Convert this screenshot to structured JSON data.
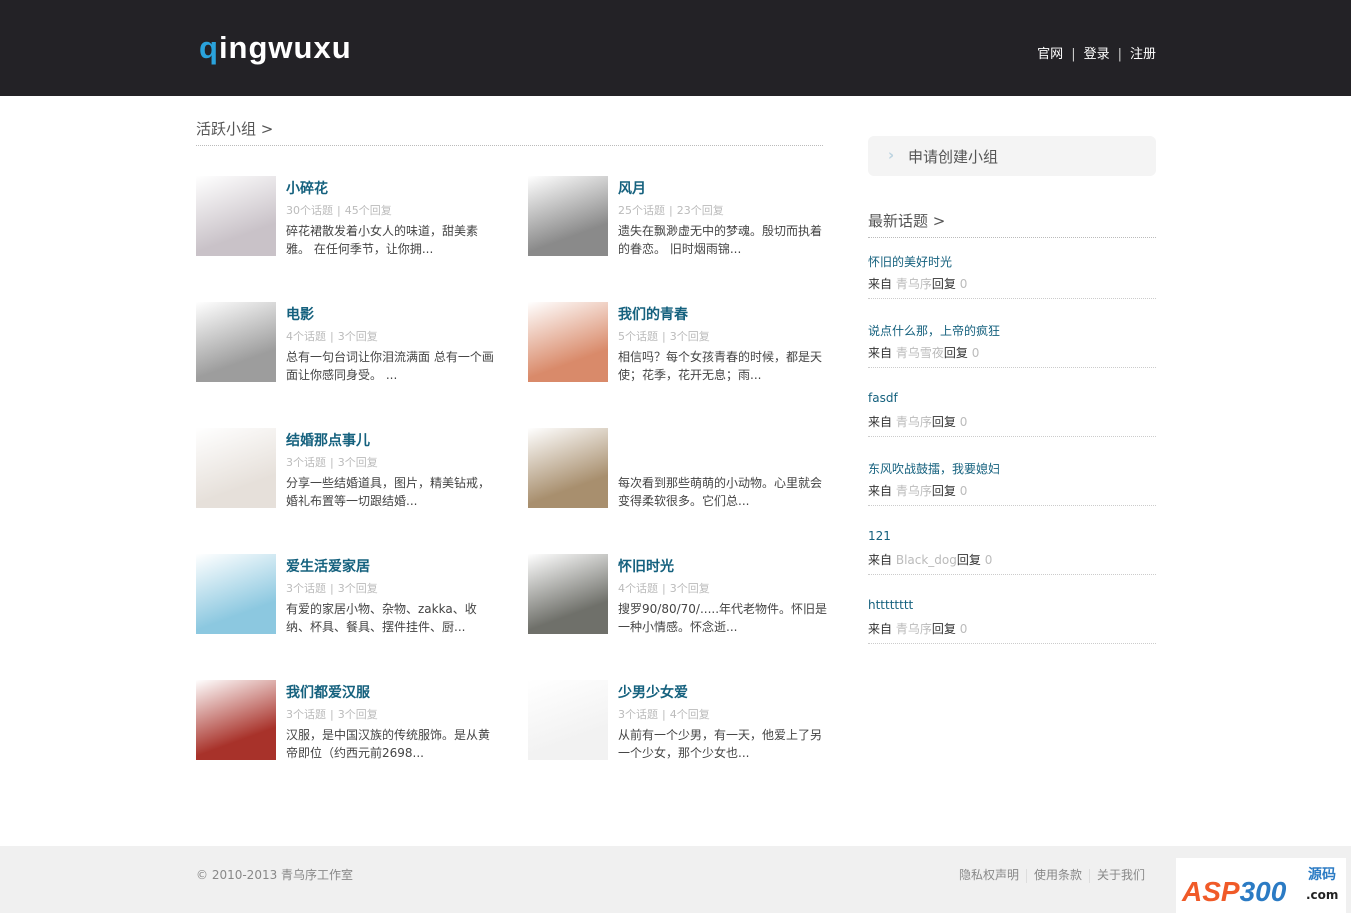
{
  "header": {
    "logo": "qingwuxu",
    "logo_first": "q",
    "logo_rest": "ingwuxu",
    "nav": [
      "官网",
      "登录",
      "注册"
    ],
    "nav_sep": "|"
  },
  "groups_section": {
    "title": "活跃小组 >",
    "groups": [
      {
        "title": "小碎花",
        "topics": "30个话题",
        "replies": "45个回复",
        "desc": "碎花裙散发着小女人的味道，甜美素雅。 在任何季节，让你拥...",
        "color": "#c9c2c8"
      },
      {
        "title": "风月",
        "topics": "25个话题",
        "replies": "23个回复",
        "desc": "遗失在飘渺虚无中的梦魂。殷切而执着的眷恋。 旧时烟雨锦...",
        "color": "#8a8a8a"
      },
      {
        "title": "电影",
        "topics": "4个话题",
        "replies": "3个回复",
        "desc": "总有一句台词让你泪流满面 总有一个画面让你感同身受。 ...",
        "color": "#9d9d9d"
      },
      {
        "title": "我们的青春",
        "topics": "5个话题",
        "replies": "3个回复",
        "desc": "相信吗？每个女孩青春的时候，都是天使；花季，花开无息；雨...",
        "color": "#d98a6a"
      },
      {
        "title": "结婚那点事儿",
        "topics": "3个话题",
        "replies": "3个回复",
        "desc": "分享一些结婚道具，图片，精美钻戒，婚礼布置等一切跟结婚...",
        "color": "#e6e0da"
      },
      {
        "title": "",
        "topics": "",
        "replies": "",
        "desc": "每次看到那些萌萌的小动物。心里就会变得柔软很多。它们总...",
        "color": "#a88f6e"
      },
      {
        "title": "爱生活爱家居",
        "topics": "3个话题",
        "replies": "3个回复",
        "desc": "有爱的家居小物、杂物、zakka、收纳、杯具、餐具、摆件挂件、厨...",
        "color": "#8cc8e0"
      },
      {
        "title": "怀旧时光",
        "topics": "4个话题",
        "replies": "3个回复",
        "desc": "搜罗90/80/70/.....年代老物件。怀旧是一种小情感。怀念逝...",
        "color": "#6f706a"
      },
      {
        "title": "我们都爱汉服",
        "topics": "3个话题",
        "replies": "3个回复",
        "desc": "汉服，是中国汉族的传统服饰。是从黄帝即位（约西元前2698...",
        "color": "#a8322a"
      },
      {
        "title": "少男少女爱",
        "topics": "3个话题",
        "replies": "4个回复",
        "desc": "从前有一个少男，有一天，他爱上了另一个少女，那个少女也...",
        "color": "#f2f2f2"
      }
    ]
  },
  "sidebar": {
    "apply_label": "申请创建小组",
    "latest_title": "最新话题 >",
    "from_label": "来自",
    "reply_label": "回复",
    "topics": [
      {
        "title": "怀旧的美好时光",
        "author": "青乌序",
        "replies": "0"
      },
      {
        "title": "说点什么那，上帝的疯狂",
        "author": "青乌雪夜",
        "replies": "0"
      },
      {
        "title": "fasdf",
        "author": "青乌序",
        "replies": "0"
      },
      {
        "title": "东风吹战鼓擂，我要媳妇",
        "author": "青乌序",
        "replies": "0"
      },
      {
        "title": "121",
        "author": "Black_dog",
        "replies": "0"
      },
      {
        "title": "htttttttt",
        "author": "青乌序",
        "replies": "0"
      }
    ]
  },
  "footer": {
    "copyright": "© 2010-2013 青乌序工作室",
    "links": [
      "隐私权声明",
      "使用条款",
      "关于我们"
    ],
    "badge": "ASP300源码.com"
  }
}
